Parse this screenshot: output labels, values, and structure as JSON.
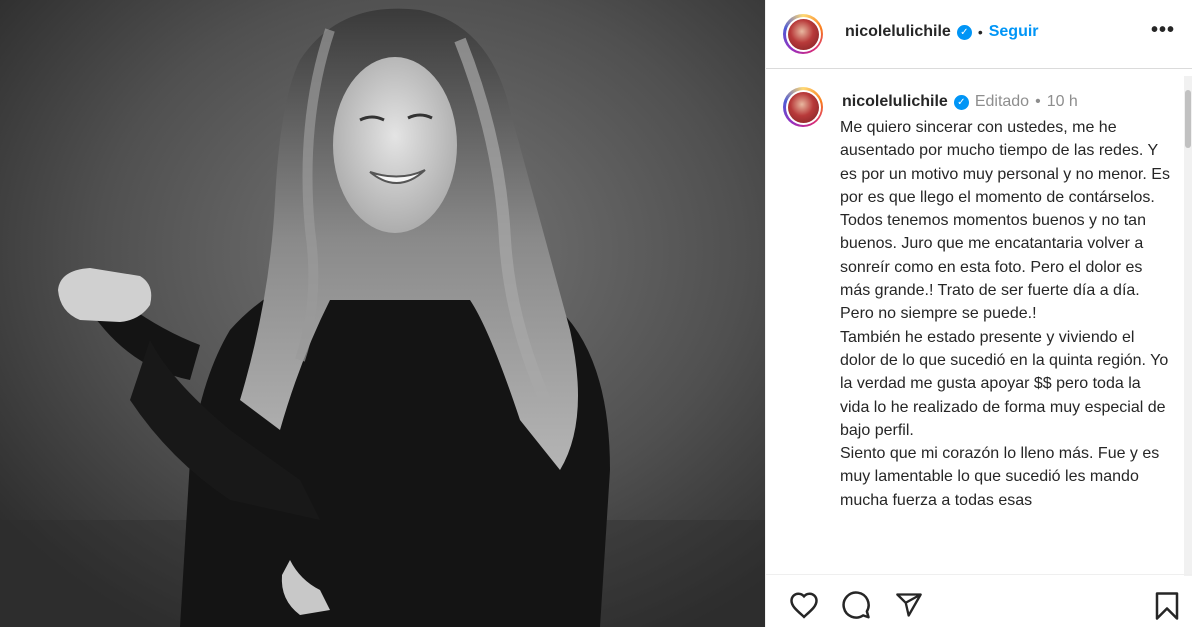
{
  "post": {
    "username": "nicolelulichile",
    "follow_label": "Seguir",
    "separator": "•",
    "more_label": "•••"
  },
  "comment": {
    "username": "nicolelulichile",
    "edited_label": "Editado",
    "separator": "•",
    "time": "10 h",
    "caption": "Me quiero sincerar con ustedes, me he ausentado por mucho tiempo de las redes. Y es por un motivo muy personal y no menor. Es por es que llego el momento de contárselos.\nTodos tenemos momentos buenos y no tan buenos. Juro que me encatantaria volver a sonreír como en esta foto. Pero el dolor es más grande.! Trato de ser fuerte día a día. Pero no siempre se puede.!\nTambién he estado presente y viviendo el dolor de lo que sucedió en la quinta región. Yo la verdad me gusta apoyar $$ pero toda la vida lo he realizado de forma muy especial de bajo perfil.\nSiento que mi corazón lo lleno más. Fue y es muy lamentable lo que sucedió les mando mucha fuerza a todas esas"
  },
  "icons": {
    "like": "heart-icon",
    "comment": "comment-icon",
    "share": "share-icon",
    "save": "bookmark-icon",
    "verified": "verified-badge-icon"
  },
  "colors": {
    "accent": "#0095f6",
    "text": "#262626",
    "muted": "#8e8e8e"
  }
}
